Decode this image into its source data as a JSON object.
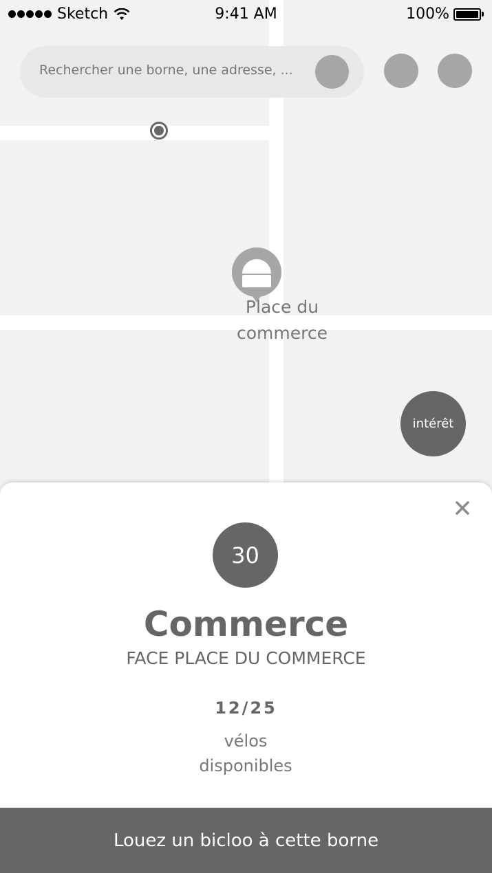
{
  "status_bar": {
    "carrier": "Sketch",
    "time": "9:41 AM",
    "battery": "100%",
    "icons": [
      "signal-dots-icon",
      "wifi-icon",
      "battery-icon"
    ]
  },
  "search": {
    "placeholder": "Rechercher une borne, une adresse, ...",
    "icon": "search-icon"
  },
  "map": {
    "station_label": "Place du commerce",
    "interest_button": "intérêt",
    "icons": [
      "location-dot-icon",
      "station-pin-icon"
    ]
  },
  "station": {
    "bike_count": "30",
    "name": "Commerce",
    "address": "FACE PLACE DU COMMERCE",
    "availability": "12/25",
    "availability_label": "vélos disponibles",
    "rent_button": "Louez un bicloo à cette borne",
    "close_icon": "close-icon"
  },
  "colors": {
    "map_background": "#f2f2f2",
    "road": "#ffffff",
    "accent": "#666666",
    "secondary": "#a6a6a6",
    "search_background": "#e8e8e8"
  }
}
